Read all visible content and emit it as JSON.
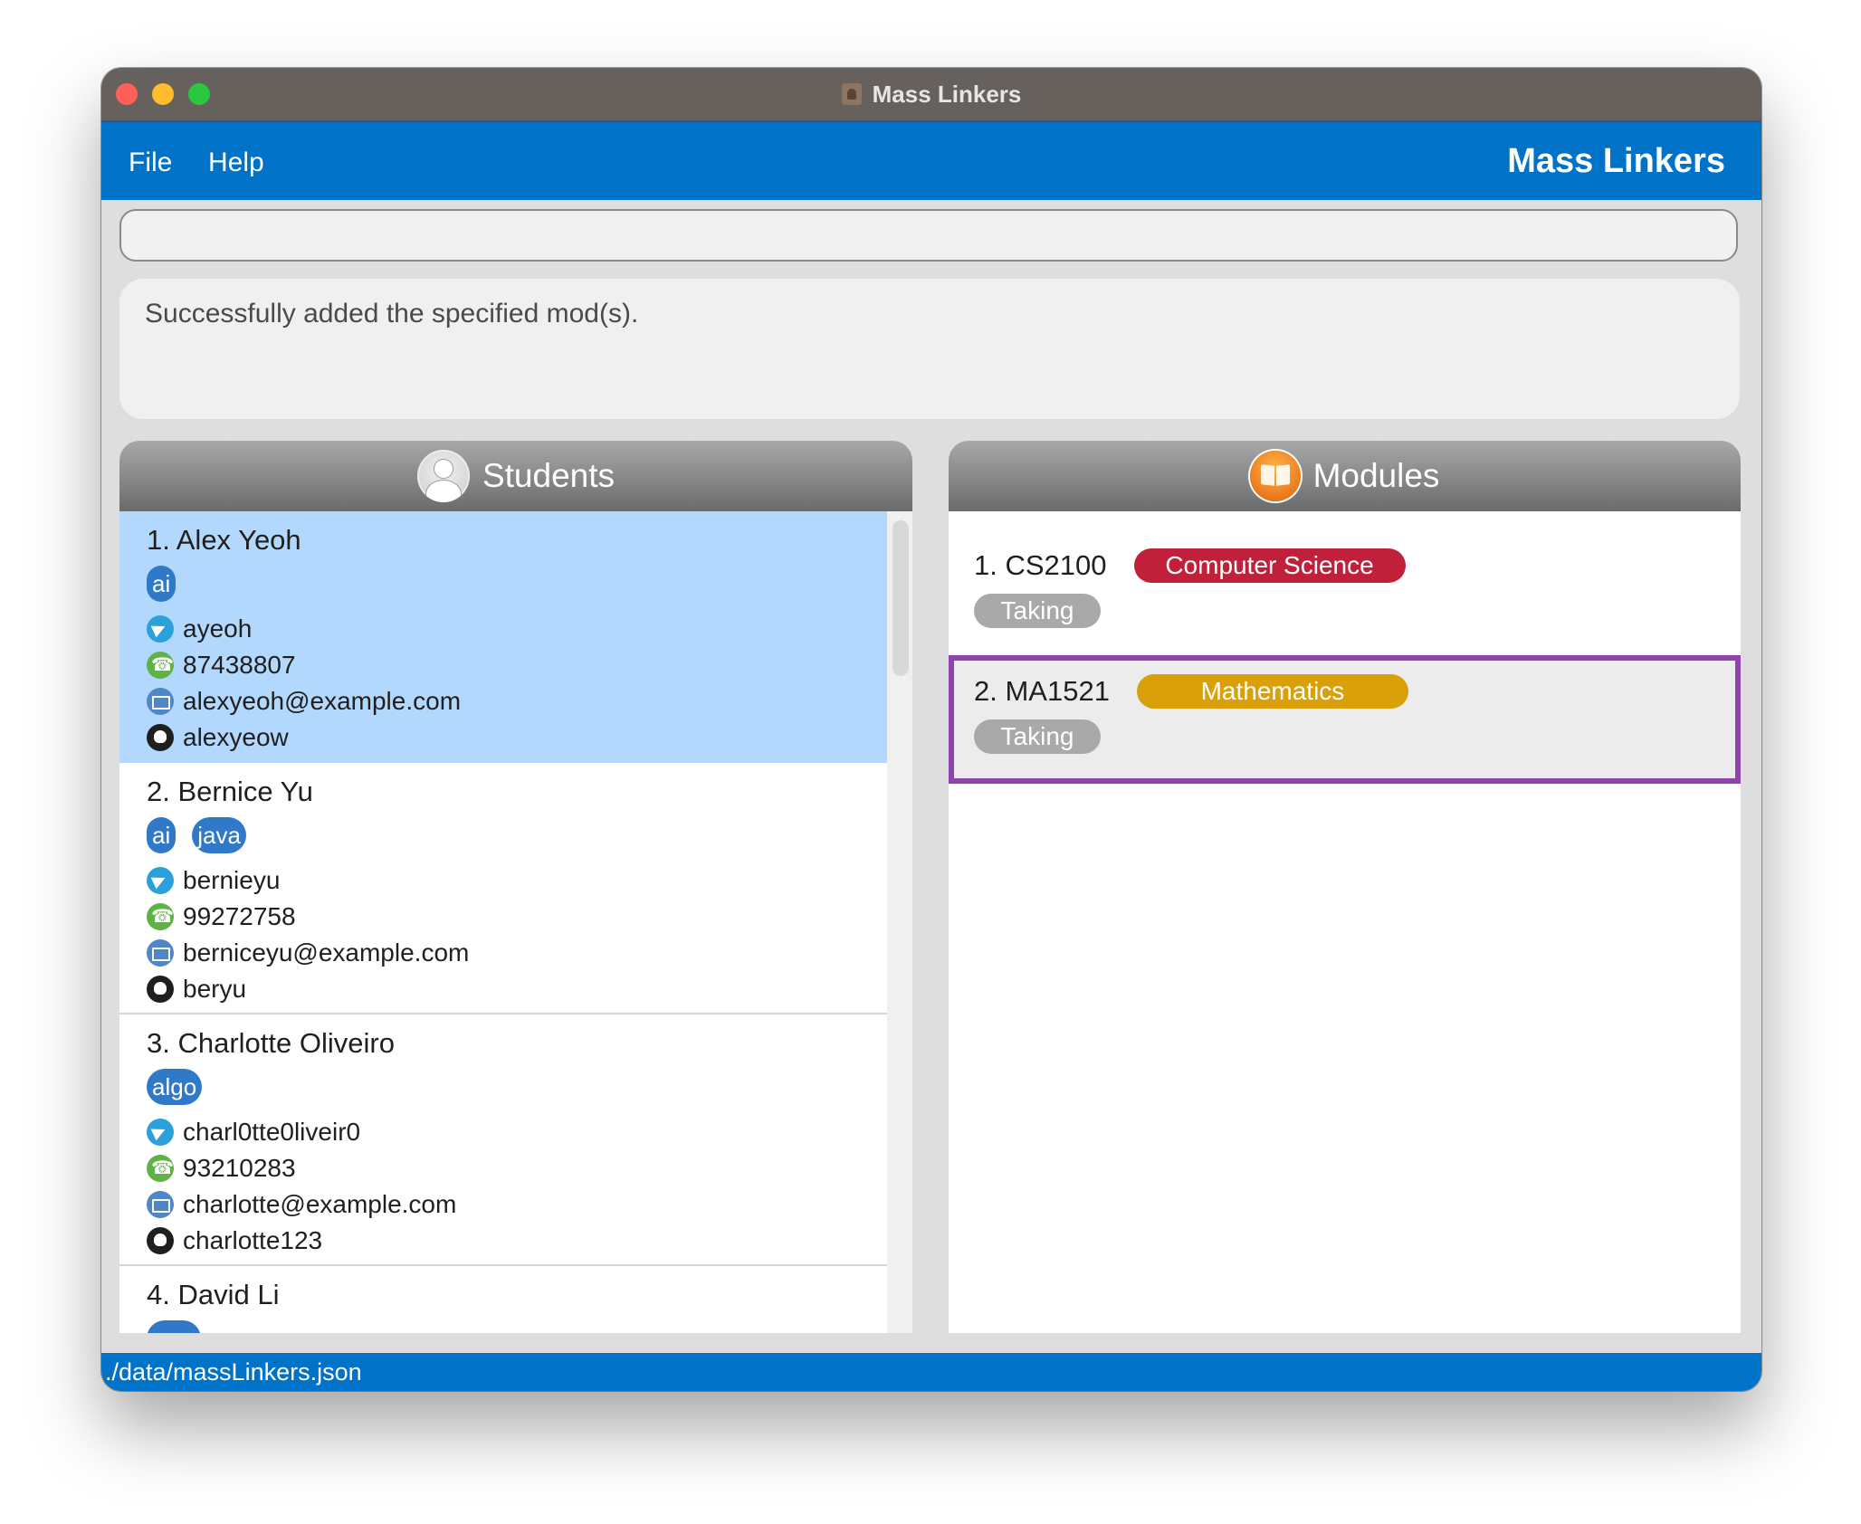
{
  "window": {
    "title": "Mass Linkers"
  },
  "menu": {
    "file": "File",
    "help": "Help",
    "brand": "Mass Linkers"
  },
  "command": {
    "value": "",
    "placeholder": ""
  },
  "result": {
    "message": "Successfully added the specified mod(s)."
  },
  "students_panel": {
    "header": "Students",
    "items": [
      {
        "name": "1. Alex Yeoh",
        "tags": [
          "ai"
        ],
        "telegram": "ayeoh",
        "phone": "87438807",
        "email": "alexyeoh@example.com",
        "github": "alexyeow",
        "selected": true
      },
      {
        "name": "2. Bernice Yu",
        "tags": [
          "ai",
          "java"
        ],
        "telegram": "bernieyu",
        "phone": "99272758",
        "email": "berniceyu@example.com",
        "github": "beryu",
        "selected": false
      },
      {
        "name": "3. Charlotte Oliveiro",
        "tags": [
          "algo"
        ],
        "telegram": "charl0tte0liveir0",
        "phone": "93210283",
        "email": "charlotte@example.com",
        "github": "charlotte123",
        "selected": false
      },
      {
        "name": "4. David Li",
        "tags": [],
        "selected": false
      }
    ]
  },
  "modules_panel": {
    "header": "Modules",
    "items": [
      {
        "name": "1. CS2100",
        "department": "Computer Science",
        "dept_color": "#c0203a",
        "status": "Taking",
        "highlighted": false
      },
      {
        "name": "2. MA1521",
        "department": "Mathematics",
        "dept_color": "#daa00a",
        "status": "Taking",
        "highlighted": true
      }
    ]
  },
  "statusbar": {
    "path": "./data/massLinkers.json"
  },
  "colors": {
    "accent": "#0073c9",
    "selected": "#b3d8fd",
    "tag": "#2f79c8",
    "highlight_border": "#8e44ad"
  }
}
